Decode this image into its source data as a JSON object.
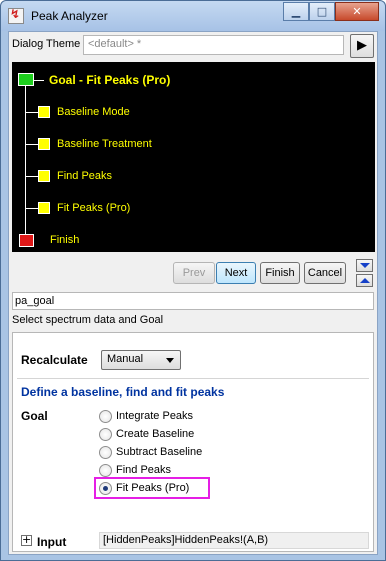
{
  "window": {
    "title": "Peak Analyzer",
    "app_icon_glyph": "↯",
    "minimize_glyph": "▁",
    "maximize_glyph": "□",
    "close_glyph": "✕"
  },
  "theme": {
    "label": "Dialog Theme",
    "value": "<default> *",
    "arrow_glyph": "▶"
  },
  "tree": {
    "goal": "Goal - Fit Peaks (Pro)",
    "steps": [
      "Baseline Mode",
      "Baseline Treatment",
      "Find Peaks",
      "Fit Peaks (Pro)"
    ],
    "finish": "Finish",
    "colors": {
      "start": "#1ecf1e",
      "step": "#ffff00",
      "finish": "#e01818"
    }
  },
  "nav": {
    "prev": "Prev",
    "next": "Next",
    "finish": "Finish",
    "cancel": "Cancel"
  },
  "node_name": "pa_goal",
  "description": "Select spectrum data and Goal",
  "recalculate": {
    "label": "Recalculate",
    "value": "Manual"
  },
  "section_title": "Define a baseline, find and fit peaks",
  "goal": {
    "label": "Goal",
    "options": [
      "Integrate Peaks",
      "Create Baseline",
      "Subtract Baseline",
      "Find Peaks",
      "Fit Peaks (Pro)"
    ],
    "selected": "Fit Peaks (Pro)"
  },
  "input": {
    "expand_glyph": "+",
    "label": "Input",
    "value": "[HiddenPeaks]HiddenPeaks!(A,B)"
  },
  "accent": {
    "highlight": "#e51ee5",
    "section_title": "#0033a0"
  }
}
